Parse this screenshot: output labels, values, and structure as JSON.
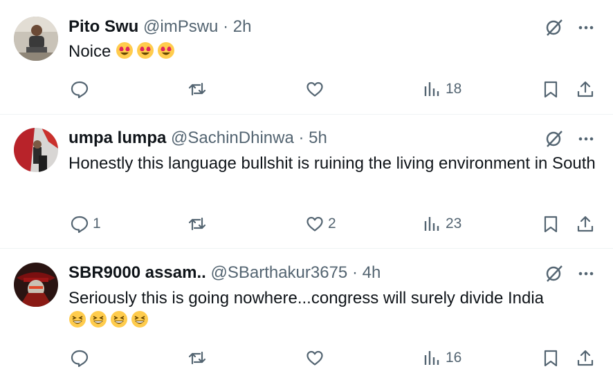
{
  "tweets": [
    {
      "name": "Pito Swu",
      "handle": "@imPswu",
      "separator": "·",
      "time": "2h",
      "text": "Noice",
      "emojis": [
        "heart-eyes",
        "heart-eyes",
        "heart-eyes"
      ],
      "replies": "",
      "retweets": "",
      "likes": "",
      "views": "18"
    },
    {
      "name": "umpa lumpa",
      "handle": "@SachinDhinwa",
      "separator": "·",
      "time": "5h",
      "text": "Honestly this language bullshit is ruining the living environment in South",
      "emojis": [],
      "replies": "1",
      "retweets": "",
      "likes": "2",
      "views": "23"
    },
    {
      "name": "SBR9000 assam..",
      "handle": "@SBarthakur3675",
      "separator": "·",
      "time": "4h",
      "text": "Seriously this is going nowhere...congress will surely divide India",
      "emojis": [
        "grinning-squint",
        "grinning-squint",
        "grinning-squint",
        "grinning-squint"
      ],
      "replies": "",
      "retweets": "",
      "likes": "",
      "views": "16"
    }
  ],
  "colors": {
    "text": "#0f1419",
    "secondary": "#536471",
    "separator": "#eff3f4",
    "emoji_yellow": "#ffcc4d",
    "emoji_heart": "#e0245e"
  }
}
